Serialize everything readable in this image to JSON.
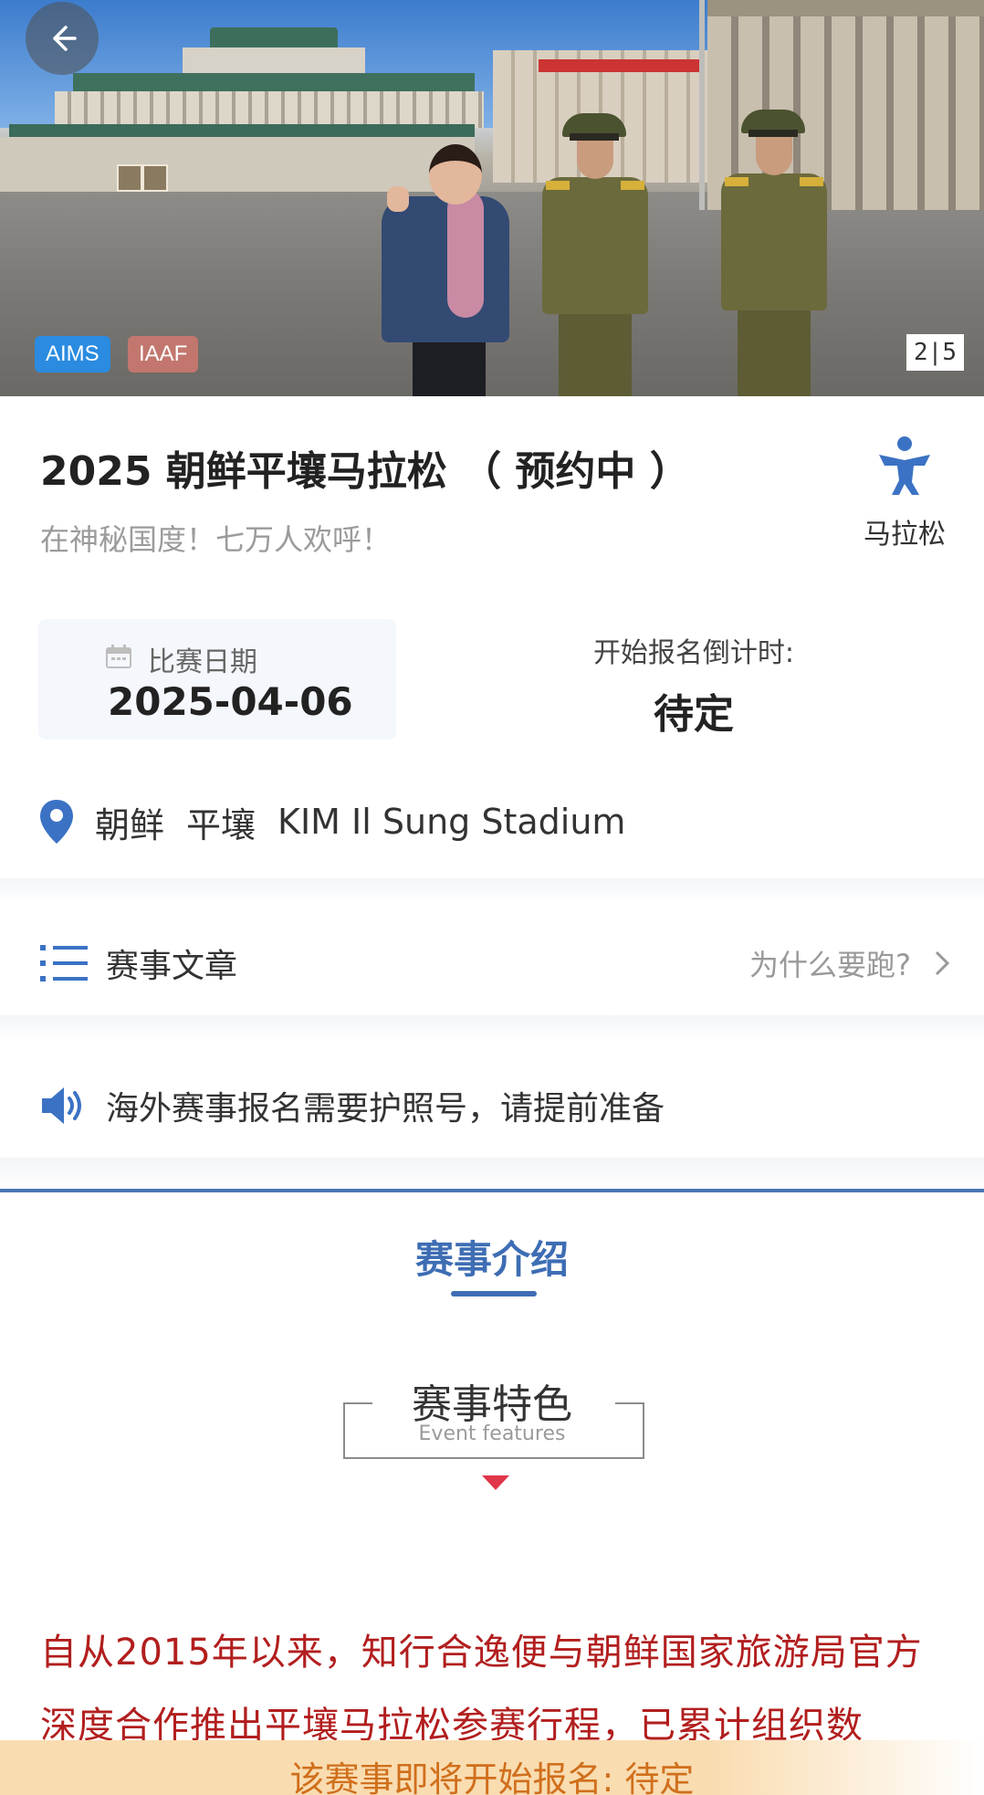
{
  "hero": {
    "badges": [
      "AIMS",
      "IAAF"
    ],
    "counter": "2|5",
    "back_icon": "arrow-left-icon"
  },
  "event": {
    "title": "2025 朝鲜平壤马拉松 （ 预约中 ）",
    "subtitle": "在神秘国度！七万人欢呼！",
    "category_label": "马拉松",
    "category_icon": "runner-icon",
    "category_color": "#3b72c4"
  },
  "date": {
    "label": "比赛日期",
    "value": "2025-04-06",
    "icon": "calendar-icon"
  },
  "countdown": {
    "label": "开始报名倒计时:",
    "value": "待定"
  },
  "location": {
    "icon": "location-pin-icon",
    "country": "朝鲜",
    "city": "平壤",
    "venue": "KIM Il Sung Stadium",
    "pin_color": "#3b72c4"
  },
  "articles": {
    "icon": "list-icon",
    "label": "赛事文章",
    "link": "为什么要跑?",
    "chevron": "chevron-right-icon"
  },
  "notice": {
    "icon": "speaker-icon",
    "text": "海外赛事报名需要护照号，请提前准备"
  },
  "intro": {
    "title": "赛事介绍",
    "feature_title": "赛事特色",
    "feature_subtitle": "Event features",
    "paragraph": "自从2015年以来，知行合逸便与朝鲜国家旅游局官方深度合作推出平壤马拉松参赛行程，已累计组织数",
    "accent_color": "#3e6db4",
    "text_color": "#b21e1e"
  },
  "bottom_bar": {
    "text": "该赛事即将开始报名: 待定"
  }
}
